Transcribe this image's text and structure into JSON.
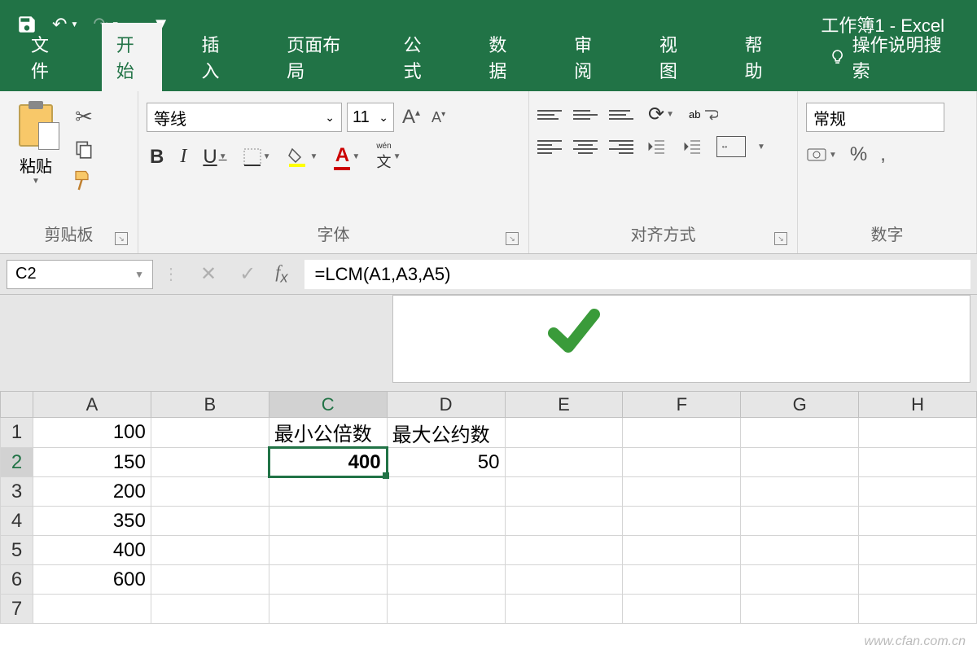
{
  "title": "工作簿1  -  Excel",
  "tabs": {
    "file": "文件",
    "home": "开始",
    "insert": "插入",
    "layout": "页面布局",
    "formulas": "公式",
    "data": "数据",
    "review": "审阅",
    "view": "视图",
    "help": "帮助",
    "tellme": "操作说明搜索"
  },
  "ribbon": {
    "clipboard": {
      "paste": "粘贴",
      "label": "剪贴板"
    },
    "font": {
      "name": "等线",
      "size": "11",
      "label": "字体",
      "wen": "wén"
    },
    "align": {
      "label": "对齐方式",
      "ab": "ab"
    },
    "number": {
      "format": "常规",
      "label": "数字",
      "percent": "%",
      "comma": ","
    }
  },
  "namebox": "C2",
  "formula": "=LCM(A1,A3,A5)",
  "columns": [
    "A",
    "B",
    "C",
    "D",
    "E",
    "F",
    "G",
    "H"
  ],
  "rows": [
    "1",
    "2",
    "3",
    "4",
    "5",
    "6",
    "7"
  ],
  "cells": {
    "A1": "100",
    "A2": "150",
    "A3": "200",
    "A4": "350",
    "A5": "400",
    "A6": "600",
    "C1": "最小公倍数",
    "D1": "最大公约数",
    "C2": "400",
    "D2": "50"
  },
  "selected_cell": "C2",
  "watermark": "www.cfan.com.cn"
}
